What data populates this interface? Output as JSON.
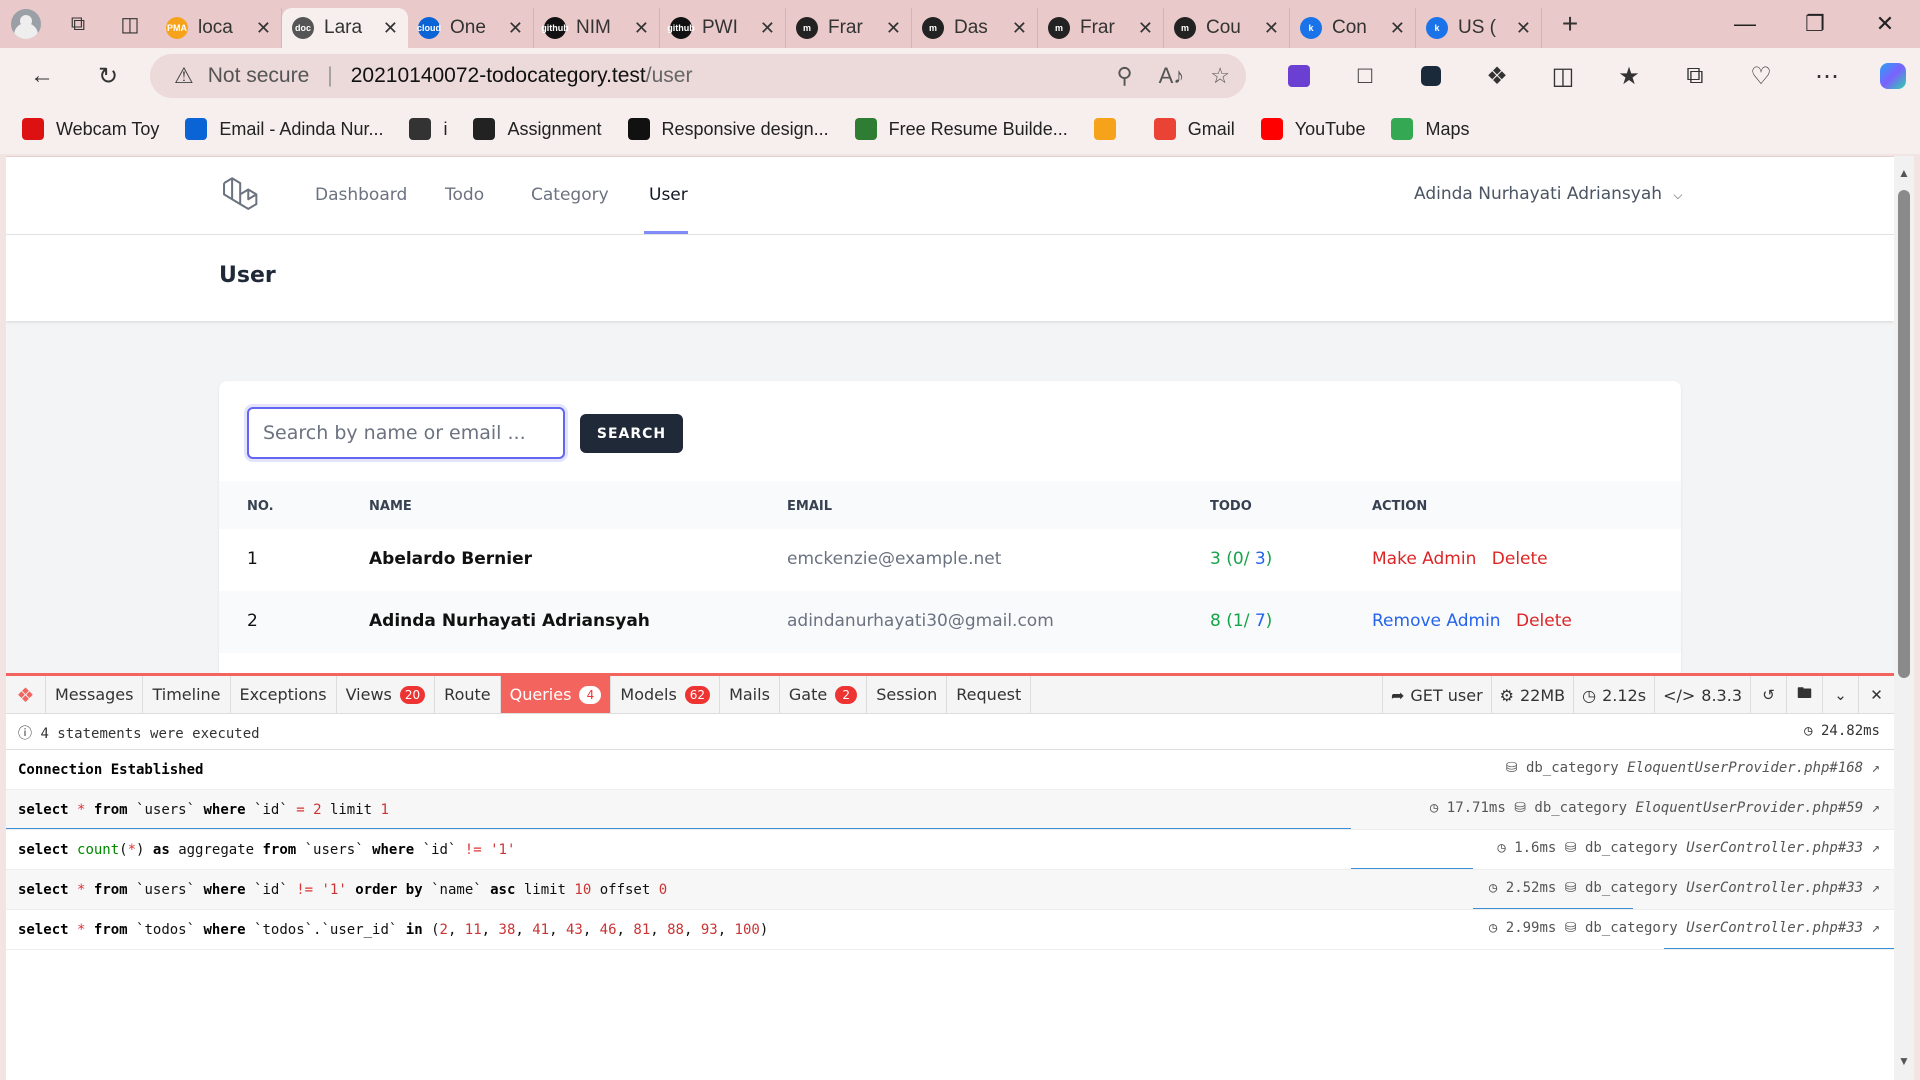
{
  "browser": {
    "tabs": [
      {
        "title": "loca",
        "favicon": "PMA",
        "color": "#f7a21b"
      },
      {
        "title": "Lara",
        "favicon": "doc",
        "color": "#555555",
        "active": true
      },
      {
        "title": "One",
        "favicon": "cloud",
        "color": "#0a64d6"
      },
      {
        "title": "NIM",
        "favicon": "github",
        "color": "#111111"
      },
      {
        "title": "PWI",
        "favicon": "github",
        "color": "#111111"
      },
      {
        "title": "Frar",
        "favicon": "m",
        "color": "#222222"
      },
      {
        "title": "Das",
        "favicon": "m",
        "color": "#222222"
      },
      {
        "title": "Frar",
        "favicon": "m",
        "color": "#222222"
      },
      {
        "title": "Cou",
        "favicon": "m",
        "color": "#222222"
      },
      {
        "title": "Con",
        "favicon": "k",
        "color": "#1a73e8"
      },
      {
        "title": "US (",
        "favicon": "k",
        "color": "#1a73e8"
      }
    ],
    "address": {
      "security": "Not secure",
      "host": "20210140072-todocategory.test",
      "path": "/user"
    },
    "bookmarks": [
      {
        "label": "Webcam Toy",
        "color": "#d11"
      },
      {
        "label": "Email - Adinda Nur...",
        "color": "#0a64d6"
      },
      {
        "label": "i",
        "color": "#333"
      },
      {
        "label": "Assignment",
        "color": "#222"
      },
      {
        "label": "Responsive design...",
        "color": "#111"
      },
      {
        "label": "Free Resume Builde...",
        "color": "#2e7d32"
      },
      {
        "label": "",
        "color": "#f7a21b"
      },
      {
        "label": "Gmail",
        "color": "#ea4335"
      },
      {
        "label": "YouTube",
        "color": "#ff0000"
      },
      {
        "label": "Maps",
        "color": "#34a853"
      }
    ]
  },
  "app": {
    "nav": {
      "links": [
        "Dashboard",
        "Todo",
        "Category",
        "User"
      ],
      "active": "User",
      "user_name": "Adinda Nurhayati Adriansyah"
    },
    "page_title": "User",
    "search": {
      "placeholder": "Search by name or email ...",
      "button": "SEARCH"
    },
    "table": {
      "headers": [
        "NO.",
        "NAME",
        "EMAIL",
        "TODO",
        "ACTION"
      ],
      "rows": [
        {
          "no": "1",
          "name": "Abelardo Bernier",
          "email": "emckenzie@example.net",
          "todo_total": "3",
          "todo_done": "0",
          "todo_open": "3",
          "action": "Make Admin",
          "delete": "Delete"
        },
        {
          "no": "2",
          "name": "Adinda Nurhayati Adriansyah",
          "email": "adindanurhayati30@gmail.com",
          "todo_total": "8",
          "todo_done": "1",
          "todo_open": "7",
          "action": "Remove Admin",
          "delete": "Delete"
        }
      ]
    }
  },
  "debugbar": {
    "tabs": [
      {
        "label": "Messages"
      },
      {
        "label": "Timeline"
      },
      {
        "label": "Exceptions"
      },
      {
        "label": "Views",
        "badge": "20"
      },
      {
        "label": "Route"
      },
      {
        "label": "Queries",
        "badge": "4",
        "active": true
      },
      {
        "label": "Models",
        "badge": "62"
      },
      {
        "label": "Mails"
      },
      {
        "label": "Gate",
        "badge": "2"
      },
      {
        "label": "Session"
      },
      {
        "label": "Request"
      }
    ],
    "right": {
      "method": "GET user",
      "memory": "22MB",
      "time": "2.12s",
      "php": "8.3.3"
    },
    "status": "4 statements were executed",
    "total_time": "24.82ms",
    "connection": {
      "text": "Connection Established",
      "db": "db_category",
      "source": "EloquentUserProvider.php#168"
    },
    "queries": [
      {
        "sql": "select * from `users` where `id` = 2 limit 1",
        "time": "17.71ms",
        "db": "db_category",
        "source": "EloquentUserProvider.php#59"
      },
      {
        "sql": "select count(*) as aggregate from `users` where `id` != '1'",
        "time": "1.6ms",
        "db": "db_category",
        "source": "UserController.php#33"
      },
      {
        "sql": "select * from `users` where `id` != '1' order by `name` asc limit 10 offset 0",
        "time": "2.52ms",
        "db": "db_category",
        "source": "UserController.php#33"
      },
      {
        "sql": "select * from `todos` where `todos`.`user_id` in (2, 11, 38, 41, 43, 46, 81, 88, 93, 100)",
        "time": "2.99ms",
        "db": "db_category",
        "source": "UserController.php#33"
      }
    ]
  },
  "colors": {
    "accent": "#6366f1",
    "debug_red": "#f4645f",
    "link_red": "#dc2626",
    "link_blue": "#2563eb",
    "todo_green": "#16a34a"
  }
}
